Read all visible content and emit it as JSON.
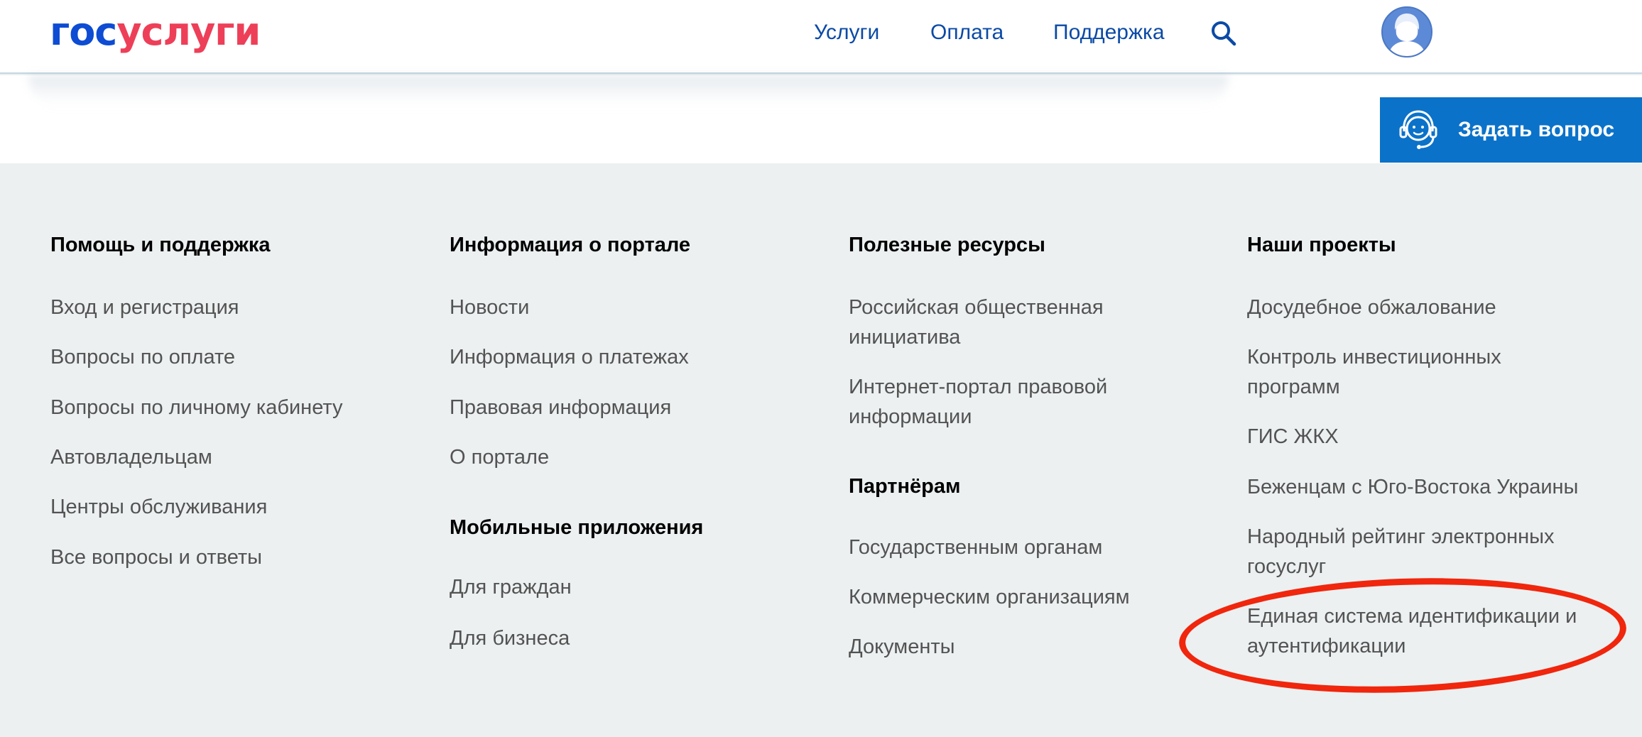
{
  "header": {
    "logo": {
      "part1": "гос",
      "part2": "услуги"
    },
    "nav": [
      "Услуги",
      "Оплата",
      "Поддержка"
    ]
  },
  "ask_button": {
    "label": "Задать вопрос"
  },
  "footer": {
    "help": {
      "heading": "Помощь и поддержка",
      "links": [
        "Вход и регистрация",
        "Вопросы по оплате",
        "Вопросы по личному кабинету",
        "Автовладельцам",
        "Центры обслуживания",
        "Все вопросы и ответы"
      ]
    },
    "portal_info": {
      "heading": "Информация о портале",
      "links": [
        "Новости",
        "Информация о платежах",
        "Правовая информация",
        "О портале"
      ]
    },
    "mobile": {
      "heading": "Мобильные приложения",
      "links": [
        "Для граждан",
        "Для бизнеса"
      ]
    },
    "resources": {
      "heading": "Полезные ресурсы",
      "links": [
        "Российская общественная инициатива",
        "Интернет-портал правовой информации"
      ]
    },
    "partners": {
      "heading": "Партнёрам",
      "links": [
        "Государственным органам",
        "Коммерческим организациям",
        "Документы"
      ]
    },
    "projects": {
      "heading": "Наши проекты",
      "links": [
        "Досудебное обжалование",
        "Контроль инвестиционных программ",
        "ГИС ЖКХ",
        "Беженцам с Юго-Востока Украины",
        "Народный рейтинг электронных госуслуг",
        "Единая система идентификации и аутентификации"
      ]
    }
  },
  "colors": {
    "brand_blue": "#0d4cd3",
    "brand_red": "#ee3f58",
    "nav_blue": "#0b4aa6",
    "ask_button_bg": "#0b72c9",
    "footer_bg": "#ecf0f1",
    "highlight_red": "#f0260d"
  },
  "icons": [
    "search-icon",
    "user-avatar-icon",
    "support-headset-icon"
  ]
}
